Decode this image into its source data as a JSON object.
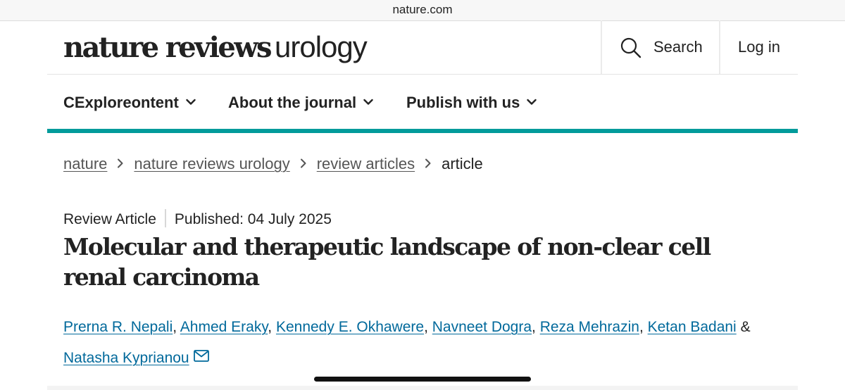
{
  "browser": {
    "url": "nature.com"
  },
  "header": {
    "logo_bold": "nature reviews",
    "logo_light": "urology",
    "search_label": "Search",
    "login_label": "Log in",
    "search_icon": "search-icon"
  },
  "nav": {
    "items": [
      {
        "label": "CExploreontent",
        "icon": "chevron-down-icon"
      },
      {
        "label": "About the journal",
        "icon": "chevron-down-icon"
      },
      {
        "label": "Publish with us",
        "icon": "chevron-down-icon"
      }
    ],
    "accent_color": "#029b9b"
  },
  "breadcrumb": {
    "items": [
      "nature",
      "nature reviews urology",
      "review articles"
    ],
    "current": "article"
  },
  "article": {
    "type": "Review Article",
    "published": "Published: 04 July 2025",
    "title": "Molecular and therapeutic landscape of non-clear cell renal carcinoma",
    "authors": [
      "Prerna R. Nepali",
      "Ahmed Eraky",
      "Kennedy E. Okhawere",
      "Navneet Dogra",
      "Reza Mehrazin",
      "Ketan Badani",
      "Natasha Kyprianou"
    ],
    "author_separator": ",",
    "author_last_joiner": "&",
    "contact_icon": "mail-icon",
    "link_color": "#01699b"
  }
}
